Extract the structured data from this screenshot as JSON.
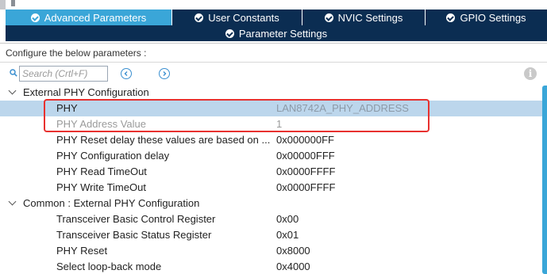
{
  "tabs": [
    {
      "label": "Advanced Parameters",
      "active": true
    },
    {
      "label": "User Constants",
      "active": false
    },
    {
      "label": "NVIC Settings",
      "active": false
    },
    {
      "label": "GPIO Settings",
      "active": false
    }
  ],
  "sub_tab": {
    "label": "Parameter Settings"
  },
  "config_label": "Configure the below parameters :",
  "search": {
    "placeholder": "Search (Crtl+F)"
  },
  "info_icon": "i",
  "groups": [
    {
      "label": "External PHY Configuration",
      "expanded": true,
      "rows": [
        {
          "name": "PHY",
          "value": "LAN8742A_PHY_ADDRESS",
          "selected": true,
          "disabled": false
        },
        {
          "name": "PHY Address Value",
          "value": "1",
          "selected": false,
          "disabled": true
        },
        {
          "name": "PHY Reset delay these values are based on ...",
          "value": "0x000000FF",
          "selected": false,
          "disabled": false
        },
        {
          "name": "PHY Configuration delay",
          "value": "0x00000FFF",
          "selected": false,
          "disabled": false
        },
        {
          "name": "PHY Read TimeOut",
          "value": "0x0000FFFF",
          "selected": false,
          "disabled": false
        },
        {
          "name": "PHY Write TimeOut",
          "value": "0x0000FFFF",
          "selected": false,
          "disabled": false
        }
      ]
    },
    {
      "label": "Common : External PHY Configuration",
      "expanded": true,
      "rows": [
        {
          "name": "Transceiver Basic Control Register",
          "value": "0x00",
          "selected": false,
          "disabled": false
        },
        {
          "name": "Transceiver Basic Status Register",
          "value": "0x01",
          "selected": false,
          "disabled": false
        },
        {
          "name": "PHY Reset",
          "value": "0x8000",
          "selected": false,
          "disabled": false
        },
        {
          "name": "Select loop-back mode",
          "value": "0x4000",
          "selected": false,
          "disabled": false
        }
      ]
    }
  ],
  "colors": {
    "tab_bg": "#0b2d52",
    "tab_active_bg": "#3aa6d8",
    "selected_row_bg": "#bcd6ec",
    "highlight_box": "#e8312f",
    "scrollbar": "#3aa6d8"
  }
}
